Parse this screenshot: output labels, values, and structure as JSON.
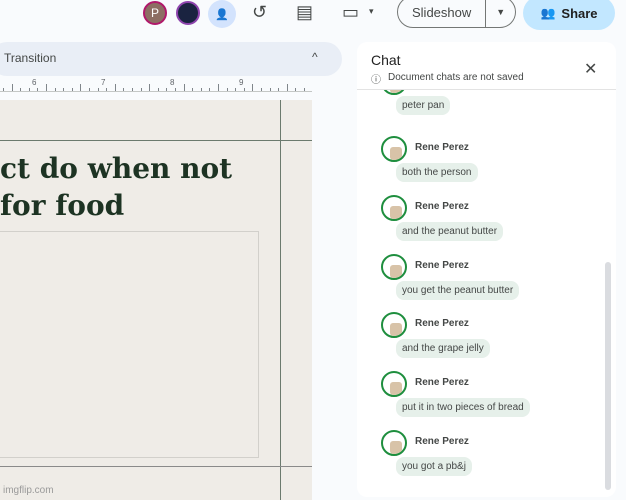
{
  "header": {
    "avatar_initial": "P",
    "slideshow_label": "Slideshow",
    "share_label": "Share"
  },
  "toolbar": {
    "transition_label": "Transition"
  },
  "ruler": {
    "labels": [
      "6",
      "7",
      "8",
      "9"
    ]
  },
  "slide": {
    "title": "ct do when not\nfor food",
    "watermark": "imgflip.com"
  },
  "chat": {
    "title": "Chat",
    "subtitle": "Document chats are not saved",
    "first_bubble": "peter pan",
    "messages": [
      {
        "author": "Rene Perez",
        "text": "both the person"
      },
      {
        "author": "Rene Perez",
        "text": "and the peanut butter"
      },
      {
        "author": "Rene Perez",
        "text": "you get the peanut butter"
      },
      {
        "author": "Rene Perez",
        "text": "and the grape jelly"
      },
      {
        "author": "Rene Perez",
        "text": "put it in two pieces of bread"
      },
      {
        "author": "Rene Perez",
        "text": "you got a pb&j"
      }
    ]
  },
  "colors": {
    "accent": "#c2e7ff",
    "bubble": "#e6f0ea",
    "avatar_ring": "#1e8e3e"
  }
}
